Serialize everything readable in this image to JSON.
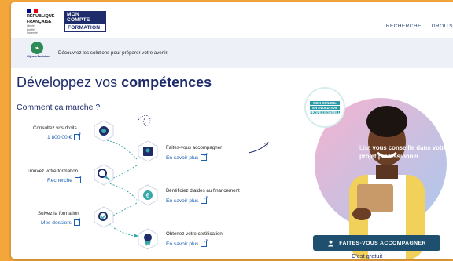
{
  "header": {
    "rf_lines": [
      "RÉPUBLIQUE",
      "FRANÇAISE"
    ],
    "rf_motto": [
      "Liberté",
      "Égalité",
      "Fraternité"
    ],
    "logo_line1": "MON COMPTE",
    "logo_line2": "FORMATION",
    "nav": [
      "RECHERCHE",
      "DROITS"
    ]
  },
  "banner": {
    "hashtag": "#1jeune1solution",
    "text": "Découvrez les solutions pour préparer votre avenir."
  },
  "main": {
    "title_plain": "Développez vos ",
    "title_bold": "compétences",
    "subtitle": "Comment ça marche ?",
    "steps_left": [
      {
        "label": "Consultez vos droits",
        "link": "1 800,00 €"
      },
      {
        "label": "Trouvez votre formation",
        "link": "Recherche"
      },
      {
        "label": "Suivez la formation",
        "link": "Mes dossiers"
      }
    ],
    "steps_right": [
      {
        "label": "Faites-vous accompagner",
        "link": "En savoir plus"
      },
      {
        "label": "Bénéficiez d'aides au financement",
        "link": "En savoir plus"
      },
      {
        "label": "Obtenez votre certification",
        "link": "En savoir plus"
      }
    ]
  },
  "promo": {
    "badge": [
      "MON CONSEIL",
      "EN ÉVOLUTION",
      "PROFESSIONNELLE"
    ],
    "quote_pre": "Lisa ",
    "quote_bold": "vous conseille dans votre projet professionnel",
    "cta": "FAITES-VOUS ACCOMPAGNER",
    "free": "C'est gratuit !"
  },
  "colors": {
    "navy": "#1e2c6b",
    "link": "#1c5fb0",
    "teal": "#2a9aa8",
    "cta": "#1f4f6e",
    "orange_bg": "#f3a73a"
  }
}
